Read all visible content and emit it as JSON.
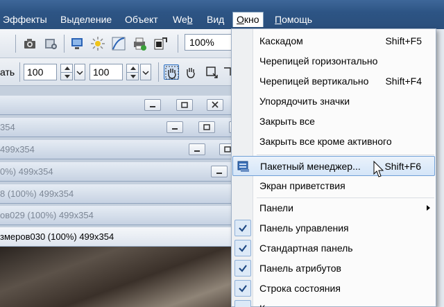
{
  "menubar": {
    "items": [
      {
        "label": "Эффекты",
        "underline_index": 0
      },
      {
        "label": "Выделение"
      },
      {
        "label": "Объект"
      },
      {
        "label_pre": "We",
        "label_u": "b",
        "label_post": ""
      },
      {
        "label": "Вид"
      },
      {
        "label_pre": "",
        "label_u": "О",
        "label_post": "кно"
      },
      {
        "label_pre": "",
        "label_u": "П",
        "label_post": "омощь"
      }
    ]
  },
  "toolbar": {
    "zoom_value": "100%",
    "scale_label_fragment": "ать",
    "width_value": "100",
    "height_value": "100",
    "icons": [
      "camera-icon",
      "scan-icon",
      "screen-capture-icon",
      "sun-icon",
      "curve-icon",
      "print-icon",
      "export-icon"
    ]
  },
  "documents": [
    {
      "title": "354"
    },
    {
      "title": "499x354"
    },
    {
      "title": "0%) 499x354"
    },
    {
      "title": "8 (100%) 499x354"
    },
    {
      "title": "ов029 (100%) 499x354"
    },
    {
      "title": "змеров030 (100%) 499x354"
    }
  ],
  "window_menu": {
    "items": [
      {
        "label": "Каскадом",
        "shortcut": "Shift+F5"
      },
      {
        "label": "Черепицей горизонтально",
        "shortcut": ""
      },
      {
        "label": "Черепицей вертикально",
        "shortcut": "Shift+F4"
      },
      {
        "label": "Упорядочить значки",
        "shortcut": ""
      },
      {
        "label": "Закрыть все",
        "shortcut": ""
      },
      {
        "label_pre": "Закрыть все кроме активного",
        "label_u": "",
        "shortcut": ""
      },
      {
        "label": "Пакетный менеджер...",
        "shortcut": "Shift+F6"
      },
      {
        "label": "Экран приветствия",
        "shortcut": ""
      },
      {
        "label": "Панели",
        "shortcut": ""
      },
      {
        "label": "Панель управления",
        "shortcut": ""
      },
      {
        "label": "Стандартная панель",
        "shortcut": ""
      },
      {
        "label": "Панель атрибутов",
        "shortcut": ""
      },
      {
        "label": "Строка состояния",
        "shortcut": ""
      },
      {
        "label": "К",
        "shortcut": ""
      }
    ]
  },
  "colors": {
    "menubar_bg": "#2d5484",
    "highlight_border": "#6f9fd6",
    "highlight_bg": "#d4e5f8"
  }
}
